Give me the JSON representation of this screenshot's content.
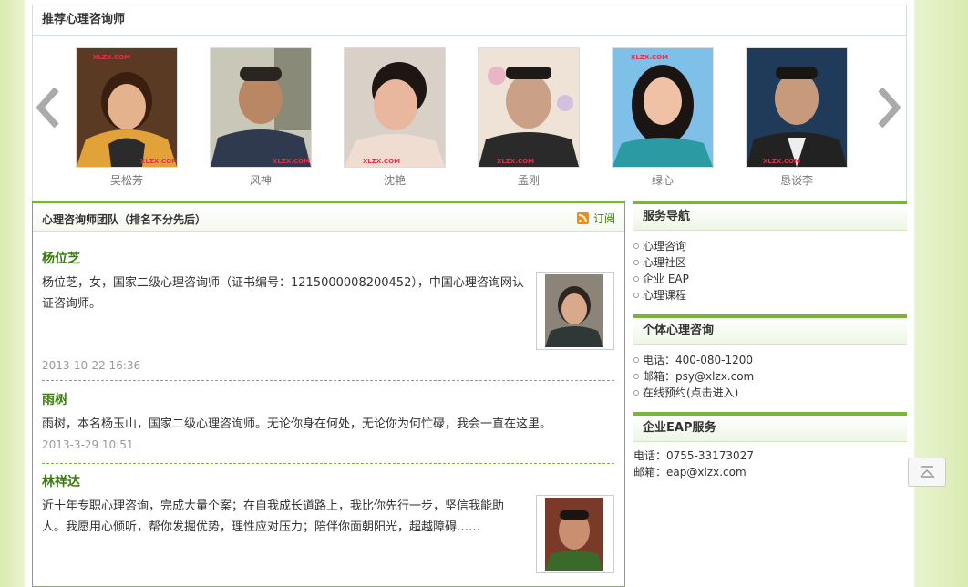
{
  "recommend": {
    "title": "推荐心理咨询师",
    "watermark": "XLZX.COM",
    "counselors": [
      {
        "name": "吴松芳"
      },
      {
        "name": "风神"
      },
      {
        "name": "沈艳"
      },
      {
        "name": "孟刚"
      },
      {
        "name": "绿心"
      },
      {
        "name": "恳谈李"
      }
    ]
  },
  "team": {
    "title": "心理咨询师团队（排名不分先后）",
    "subscribe": "订阅",
    "entries": [
      {
        "name": "杨位芝",
        "text": "杨位芝，女，国家二级心理咨询师（证书编号：1215000008200452），中国心理咨询网认证咨询师。",
        "date": "2013-10-22 16:36"
      },
      {
        "name": "雨树",
        "text": "雨树，本名杨玉山，国家二级心理咨询师。无论你身在何处，无论你为何忙碌，我会一直在这里。",
        "date": "2013-3-29 10:51"
      },
      {
        "name": "林祥达",
        "text": "近十年专职心理咨询，完成大量个案；在自我成长道路上，我比你先行一步，坚信我能助人。我愿用心倾听，帮你发掘优势，理性应对压力；陪伴你面朝阳光，超越障碍……"
      }
    ]
  },
  "sidebar": {
    "nav": {
      "title": "服务导航",
      "items": [
        "心理咨询",
        "心理社区",
        "企业 EAP",
        "心理课程"
      ]
    },
    "personal": {
      "title": "个体心理咨询",
      "items": [
        "电话：400-080-1200",
        "邮箱：psy@xlzx.com",
        "在线预约(点击进入)"
      ]
    },
    "eap": {
      "title": "企业EAP服务",
      "lines": [
        "电话：0755-33173027",
        "邮箱：eap@xlzx.com"
      ]
    }
  },
  "colors": {
    "accent": "#79b53b",
    "link": "#3a7d0c"
  }
}
